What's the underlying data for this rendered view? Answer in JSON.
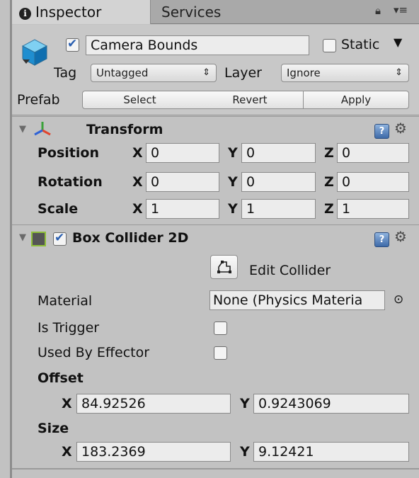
{
  "tabs": {
    "inspector": "Inspector",
    "services": "Services",
    "info_glyph": "i"
  },
  "gameobject": {
    "active": true,
    "name": "Camera Bounds",
    "static_checked": false,
    "static_label": "Static",
    "tag_label": "Tag",
    "tag_value": "Untagged",
    "layer_label": "Layer",
    "layer_value": "Ignore",
    "prefab_label": "Prefab",
    "prefab_buttons": [
      "Select",
      "Revert",
      "Apply"
    ]
  },
  "transform": {
    "title": "Transform",
    "rows": [
      {
        "label": "Position",
        "x": "0",
        "y": "0",
        "z": "0"
      },
      {
        "label": "Rotation",
        "x": "0",
        "y": "0",
        "z": "0"
      },
      {
        "label": "Scale",
        "x": "1",
        "y": "1",
        "z": "1"
      }
    ]
  },
  "box_collider": {
    "title": "Box Collider 2D",
    "enabled": true,
    "edit_collider_label": "Edit Collider",
    "material_label": "Material",
    "material_value": "None (Physics Materia",
    "is_trigger_label": "Is Trigger",
    "used_by_effector_label": "Used By Effector",
    "offset_label": "Offset",
    "offset": {
      "x": "84.92526",
      "y": "0.9243069"
    },
    "size_label": "Size",
    "size": {
      "x": "183.2369",
      "y": "9.12421"
    }
  },
  "axis_labels": {
    "x": "X",
    "y": "Y",
    "z": "Z"
  },
  "colors": {
    "background": "#c2c2c2",
    "field": "#ececec",
    "checkbox_tick": "#2a5fb0",
    "collider_icon_border": "#8fbf3a"
  },
  "icons": [
    "info-icon",
    "lock-icon",
    "menu-icon",
    "cube-icon",
    "transform-axes-icon",
    "help-icon",
    "gear-icon",
    "collider-icon",
    "edit-collider-icon",
    "object-picker-icon"
  ]
}
